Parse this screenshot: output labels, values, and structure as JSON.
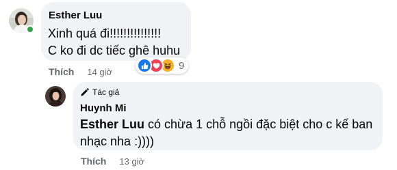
{
  "comment": {
    "author": "Esther Luu",
    "lines": [
      "Xinh quá đi!!!!!!!!!!!!!!!",
      "C ko đi dc tiếc ghê huhu"
    ],
    "like_label": "Thích",
    "time": "14 giờ",
    "reactions": {
      "icons": [
        "like-icon",
        "love-icon",
        "haha-icon"
      ],
      "count": "9"
    },
    "online_status_color": "#31a24c"
  },
  "reply": {
    "badge_label": "Tác giả",
    "author": "Huynh Mi",
    "mention": "Esther Luu",
    "text": " có chừa 1 chỗ ngồi đặc biệt cho c kế ban nhạc nha :))))",
    "like_label": "Thích",
    "time": "13 giờ"
  },
  "colors": {
    "bubble": "#f0f2f5",
    "meta_text": "#65676b",
    "like_blue": "#1877f2",
    "love_red": "#f33e58",
    "haha_yellow": "#f7b125"
  }
}
